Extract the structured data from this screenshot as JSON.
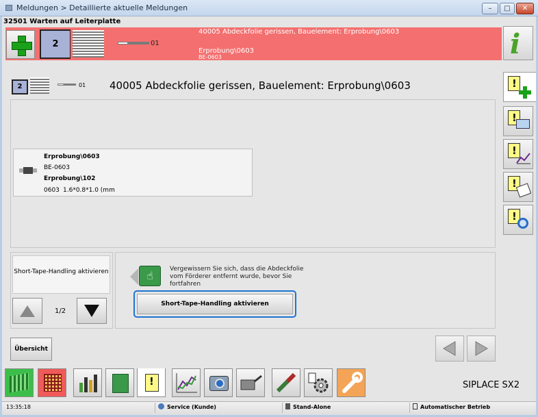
{
  "window": {
    "title": "Meldungen > Detaillierte aktuelle Meldungen",
    "min_glyph": "–",
    "max_glyph": "□",
    "close_glyph": "✕"
  },
  "status_line": "32501 Warten auf Leiterplatte",
  "banner": {
    "color": "#f46f6f",
    "slot": "2",
    "track": "01",
    "message": "40005 Abdeckfolie gerissen, Bauelement: Erprobung\\0603",
    "line2": "Erprobung\\0603",
    "line3": "BE-0603"
  },
  "detail": {
    "slot": "2",
    "track": "01",
    "heading": "40005 Abdeckfolie gerissen, Bauelement: Erprobung\\0603"
  },
  "component": {
    "name": "Erprobung\\0603",
    "be": "BE-0603",
    "package": "Erprobung\\102",
    "size_code": "0603",
    "dimensions": "1.6*0.8*1.0 (mm"
  },
  "action_list": {
    "item_label": "Short-Tape-Handling aktivieren",
    "page": "1/2"
  },
  "instruction": {
    "hint": "Vergewissern Sie sich, dass die Abdeckfolie vom Förderer entfernt wurde, bevor Sie fortfahren",
    "button_label": "Short-Tape-Handling aktivieren",
    "accent": "#1c74d4"
  },
  "overview_button": "Übersicht",
  "brand": "SIPLACE SX2",
  "statusbar": {
    "time": "13:35:18",
    "service": "Service (Kunde)",
    "mode": "Stand-Alone",
    "operation": "Automatischer Betrieb"
  },
  "icons": {
    "right_toolbar": [
      "info-icon",
      "alarm-add-icon",
      "alarm-monitor-icon",
      "alarm-chart-icon",
      "alarm-hand-icon",
      "alarm-magnifier-icon"
    ],
    "bottom_bar": [
      "feeder-icon",
      "board-grid-icon",
      "bar-chart-icon",
      "circuit-board-icon",
      "alarm-icon",
      "line-chart-icon",
      "camera-icon",
      "oil-can-icon",
      "nozzle-icon",
      "hand-gear-icon",
      "wrench-icon"
    ]
  }
}
